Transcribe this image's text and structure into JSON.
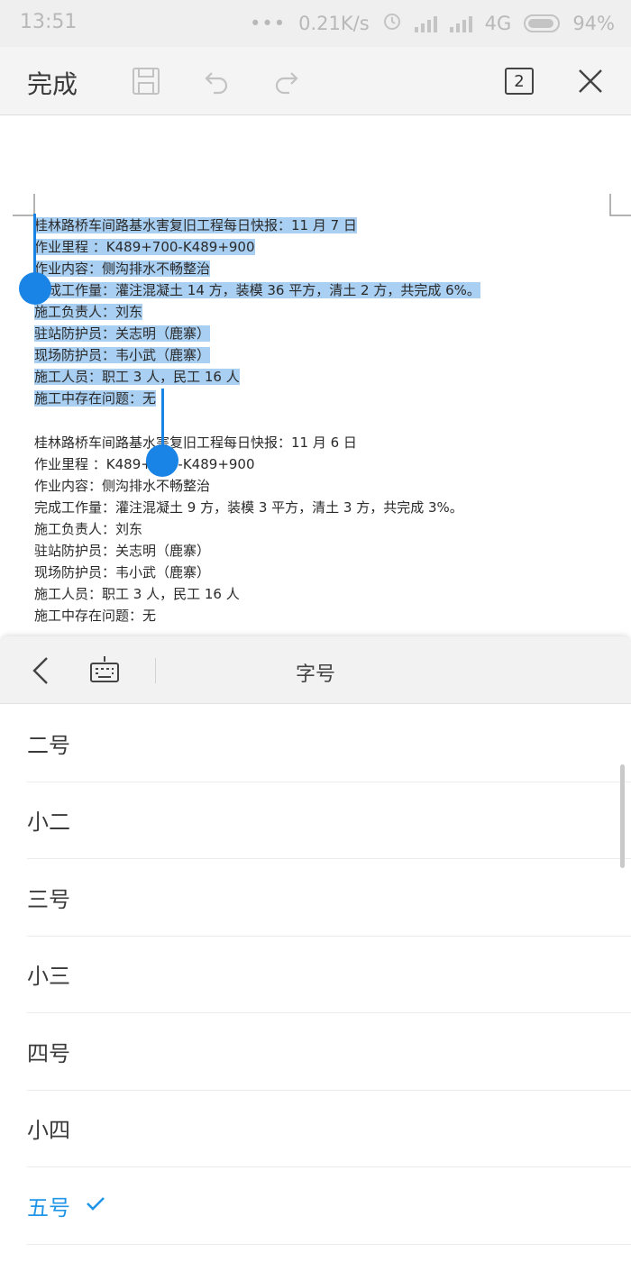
{
  "status_bar": {
    "time": "13:51",
    "dots": "•••",
    "network_speed": "0.21K/s",
    "network_type": "4G",
    "battery": "94%"
  },
  "toolbar": {
    "done_label": "完成",
    "page_count": "2"
  },
  "document": {
    "report_1": {
      "lines": [
        "桂林路桥车间路基水害复旧工程每日快报：11 月 7 日",
        "作业里程 ：K489+700-K489+900",
        "作业内容：侧沟排水不畅整治",
        "完成工作量：灌注混凝土 14 方，装模 36 平方，清土 2 方，共完成 6%。",
        "施工负责人：刘东",
        "驻站防护员：关志明（鹿寨）",
        "现场防护员：韦小武（鹿寨）",
        "施工人员：职工 3 人，民工 16 人",
        "施工中存在问题：无"
      ]
    },
    "report_2": {
      "lines": [
        "桂林路桥车间路基水害复旧工程每日快报：11 月 6 日",
        "作业里程 ：K489+700-K489+900",
        "作业内容：侧沟排水不畅整治",
        "完成工作量：灌注混凝土 9 方，装模 3 平方，清土 3 方，共完成 3%。",
        "施工负责人：刘东",
        "驻站防护员：关志明（鹿寨）",
        "现场防护员：韦小武（鹿寨）",
        "施工人员：职工 3 人，民工 16 人",
        "施工中存在问题：无"
      ]
    }
  },
  "panel": {
    "title": "字号",
    "sizes": [
      {
        "label": "二号",
        "selected": false
      },
      {
        "label": "小二",
        "selected": false
      },
      {
        "label": "三号",
        "selected": false
      },
      {
        "label": "小三",
        "selected": false
      },
      {
        "label": "四号",
        "selected": false
      },
      {
        "label": "小四",
        "selected": false
      },
      {
        "label": "五号",
        "selected": true
      }
    ]
  },
  "colors": {
    "accent": "#2196e8",
    "selection": "#a9cff2",
    "handle": "#1a84e6"
  }
}
